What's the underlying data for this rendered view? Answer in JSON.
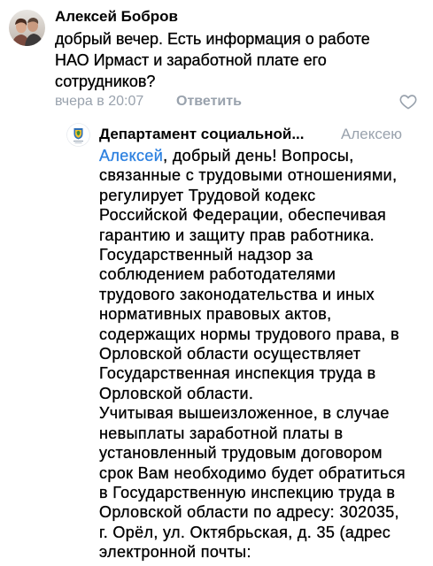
{
  "comment": {
    "author": "Алексей Бобров",
    "avatar_icon": "user-photo-avatar",
    "text_lines": [
      "добрый вечер. Есть информация о работе",
      "НАО Ирмаст и заработной плате его",
      "сотрудников?"
    ],
    "time": "вчера в 20:07",
    "reply_label": "Ответить",
    "like_icon": "heart-icon"
  },
  "reply": {
    "author": "Департамент социальной...",
    "avatar_icon": "department-emblem-avatar",
    "reply_to": "Алексею",
    "mention": "Алексей",
    "first_line_rest": ", добрый день! Вопросы,",
    "text_lines": [
      "связанные с трудовыми отношениями,",
      "регулирует Трудовой кодекс",
      "Российской Федерации, обеспечивая",
      "гарантию и защиту прав работника.",
      "Государственный надзор за",
      "соблюдением работодателями",
      "трудового законодательства и иных",
      "нормативных правовых актов,",
      "содержащих нормы трудового права, в",
      "Орловской области осуществляет",
      "Государственная инспекция труда в",
      "Орловской области.",
      "Учитывая вышеизложенное, в случае",
      "невыплаты заработной платы в",
      "установленный трудовым договором",
      "срок Вам необходимо будет обратиться",
      "в Государственную инспекцию труда в",
      "Орловской области по адресу: 302035,",
      "г. Орёл, ул. Октябрьская, д. 35 (адрес",
      "электронной почты:"
    ]
  },
  "colors": {
    "text": "#000000",
    "secondary": "#99a2ad",
    "link": "#2d81e0",
    "background": "#ffffff"
  }
}
